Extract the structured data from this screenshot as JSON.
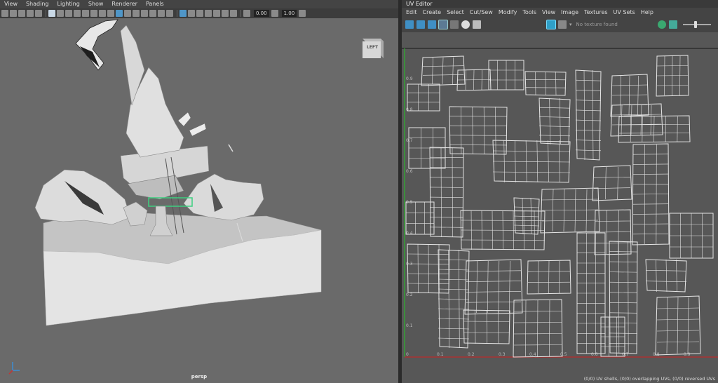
{
  "viewport": {
    "menu": [
      "View",
      "Shading",
      "Lighting",
      "Show",
      "Renderer",
      "Panels"
    ],
    "toolbar": {
      "field_a": "0.00",
      "field_b": "1.00"
    },
    "camera_label": "persp",
    "view_cube_label": "LEFT"
  },
  "uv_editor": {
    "title": "UV Editor",
    "menu": [
      "Edit",
      "Create",
      "Select",
      "Cut/Sew",
      "Modify",
      "Tools",
      "View",
      "Image",
      "Textures",
      "UV Sets",
      "Help"
    ],
    "texture_placeholder": "No texture found",
    "axis_v_ticks": [
      "0.9",
      "0.8",
      "0.7",
      "0.6",
      "0.5",
      "0.4",
      "0.3",
      "0.2",
      "0.1"
    ],
    "axis_u_ticks": [
      "0",
      "0.1",
      "0.2",
      "0.3",
      "0.4",
      "0.5",
      "0.6",
      "0.7",
      "0.8",
      "0.9"
    ],
    "status": "(0/0) UV shells, (0/0) overlapping UVs, (0/0) reversed UVs"
  },
  "colors": {
    "viewport_bg": "#6a6a6a",
    "uv_bg": "#575757",
    "uv_wire": "#e6e6e6",
    "accent_blue": "#4f96c8",
    "u_axis": "#c83232",
    "v_axis": "#32a032"
  }
}
